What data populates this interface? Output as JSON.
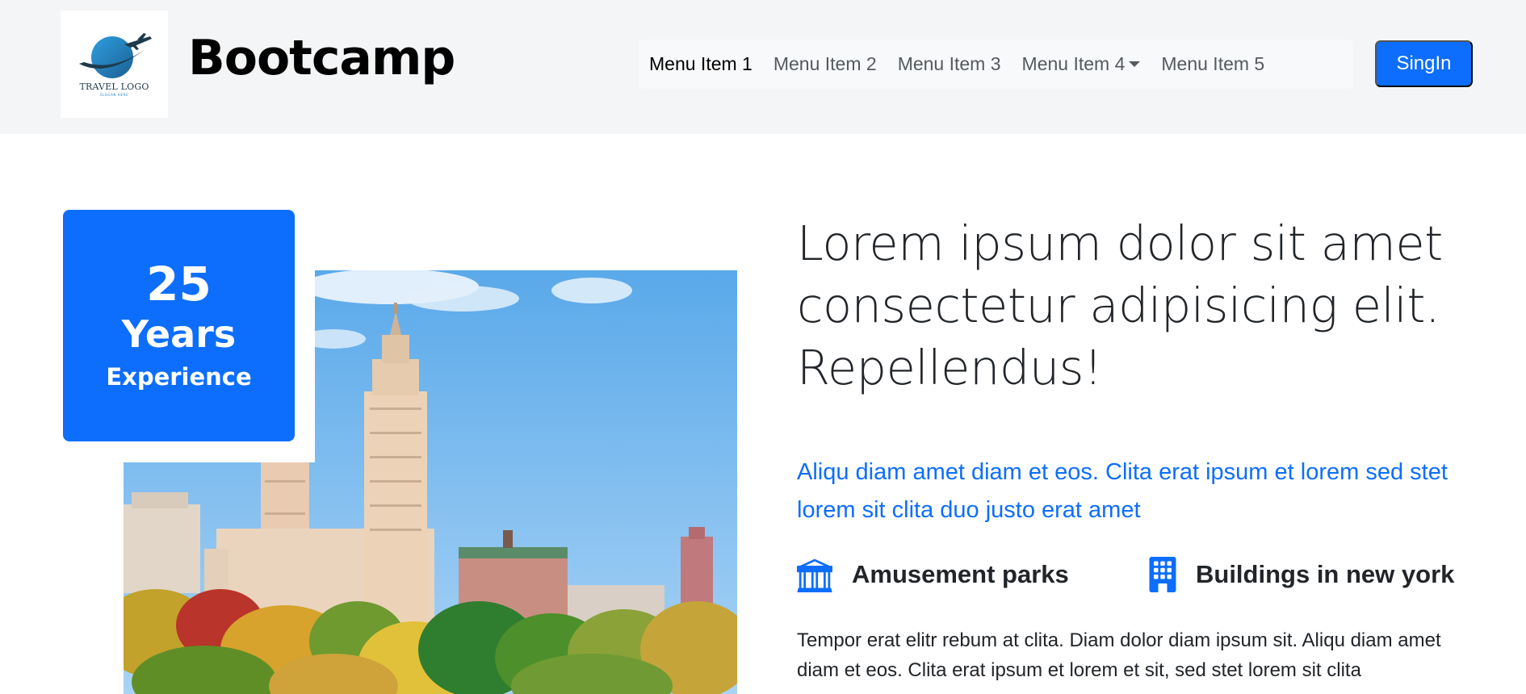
{
  "header": {
    "logo": {
      "text": "TRAVEL LOGO",
      "subtext": "SLOGAN HERE"
    },
    "brand": "Bootcamp",
    "nav": [
      {
        "label": "Menu Item 1",
        "active": true
      },
      {
        "label": "Menu Item 2",
        "active": false
      },
      {
        "label": "Menu Item 3",
        "active": false
      },
      {
        "label": "Menu Item 4",
        "active": false,
        "dropdown": true
      },
      {
        "label": "Menu Item 5",
        "active": false
      }
    ],
    "signin_label": "SingIn"
  },
  "experience": {
    "number": "25",
    "unit": "Years",
    "label": "Experience"
  },
  "content": {
    "headline": "Lorem ipsum dolor sit amet consectetur adipisicing elit. Repellendus!",
    "lead": "Aliqu diam amet diam et eos. Clita erat ipsum et lorem sed stet lorem sit clita duo justo erat amet",
    "features": [
      {
        "icon": "bank-icon",
        "label": "Amusement parks"
      },
      {
        "icon": "building-icon",
        "label": "Buildings in new york"
      }
    ],
    "body": "Tempor erat elitr rebum at clita. Diam dolor diam ipsum sit. Aliqu diam amet diam et eos. Clita erat ipsum et lorem et sit, sed stet lorem sit clita"
  },
  "colors": {
    "accent": "#0d6efd",
    "header_bg": "#f4f5f6",
    "nav_bg": "#f8f9fa"
  }
}
